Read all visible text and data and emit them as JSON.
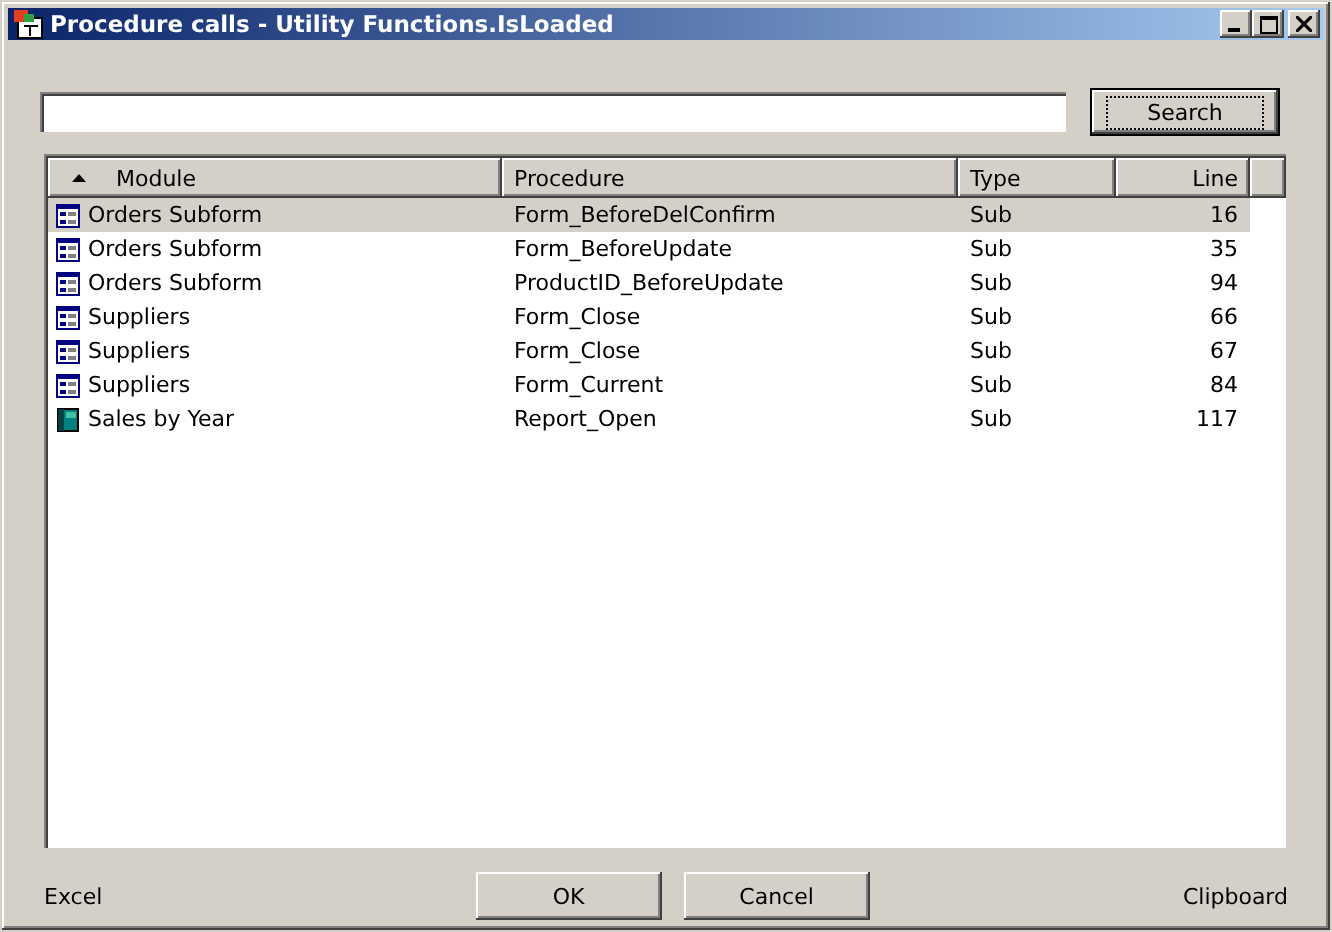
{
  "window": {
    "title": "Procedure calls - Utility Functions.IsLoaded"
  },
  "search": {
    "button": "Search"
  },
  "table": {
    "columns": [
      {
        "label": "Module",
        "sorted": true
      },
      {
        "label": "Procedure",
        "sorted": false
      },
      {
        "label": "Type",
        "sorted": false
      },
      {
        "label": "Line",
        "sorted": false
      }
    ],
    "rows": [
      {
        "kind": "form",
        "module": "Orders Subform",
        "procedure": "Form_BeforeDelConfirm",
        "type": "Sub",
        "line": "16",
        "selected": true
      },
      {
        "kind": "form",
        "module": "Orders Subform",
        "procedure": "Form_BeforeUpdate",
        "type": "Sub",
        "line": "35",
        "selected": false
      },
      {
        "kind": "form",
        "module": "Orders Subform",
        "procedure": "ProductID_BeforeUpdate",
        "type": "Sub",
        "line": "94",
        "selected": false
      },
      {
        "kind": "form",
        "module": "Suppliers",
        "procedure": "Form_Close",
        "type": "Sub",
        "line": "66",
        "selected": false
      },
      {
        "kind": "form",
        "module": "Suppliers",
        "procedure": "Form_Close",
        "type": "Sub",
        "line": "67",
        "selected": false
      },
      {
        "kind": "form",
        "module": "Suppliers",
        "procedure": "Form_Current",
        "type": "Sub",
        "line": "84",
        "selected": false
      },
      {
        "kind": "report",
        "module": "Sales by Year",
        "procedure": "Report_Open",
        "type": "Sub",
        "line": "117",
        "selected": false
      }
    ]
  },
  "footer": {
    "left_link": "Excel",
    "buttons": [
      "OK",
      "Cancel"
    ],
    "right_link": "Clipboard"
  }
}
